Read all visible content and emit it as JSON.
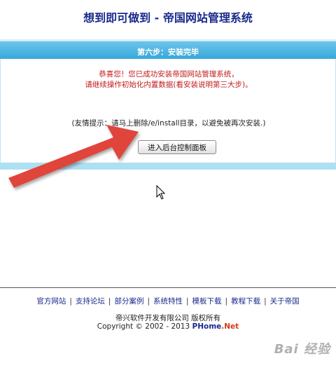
{
  "page_title": "想到即可做到 - 帝国网站管理系统",
  "step_header": "第六步：安装完毕",
  "success_line_1": "恭喜您！您已成功安装帝国网站管理系统，",
  "success_line_2": "请继续操作初始化内置数据(看安装说明第三大步)。",
  "hint": "(友情提示：请马上删除/e/install目录，以避免被再次安装.)",
  "enter_button_label": "进入后台控制面板",
  "footer": {
    "links": [
      "官方网站",
      "支持论坛",
      "部分案例",
      "系统特性",
      "模板下载",
      "教程下载",
      "关于帝国"
    ],
    "company": "帝兴软件开发有限公司 版权所有",
    "copyright_prefix": "Copyright © 2002 - 2013 ",
    "brand": "PHome",
    "brand_suffix": ".Net"
  },
  "watermark": "Bai 经验",
  "colors": {
    "title": "#1a2a8c",
    "header_bar": "#36a7dc",
    "success_text": "#c21a1a",
    "arrow": "#e0453a"
  }
}
